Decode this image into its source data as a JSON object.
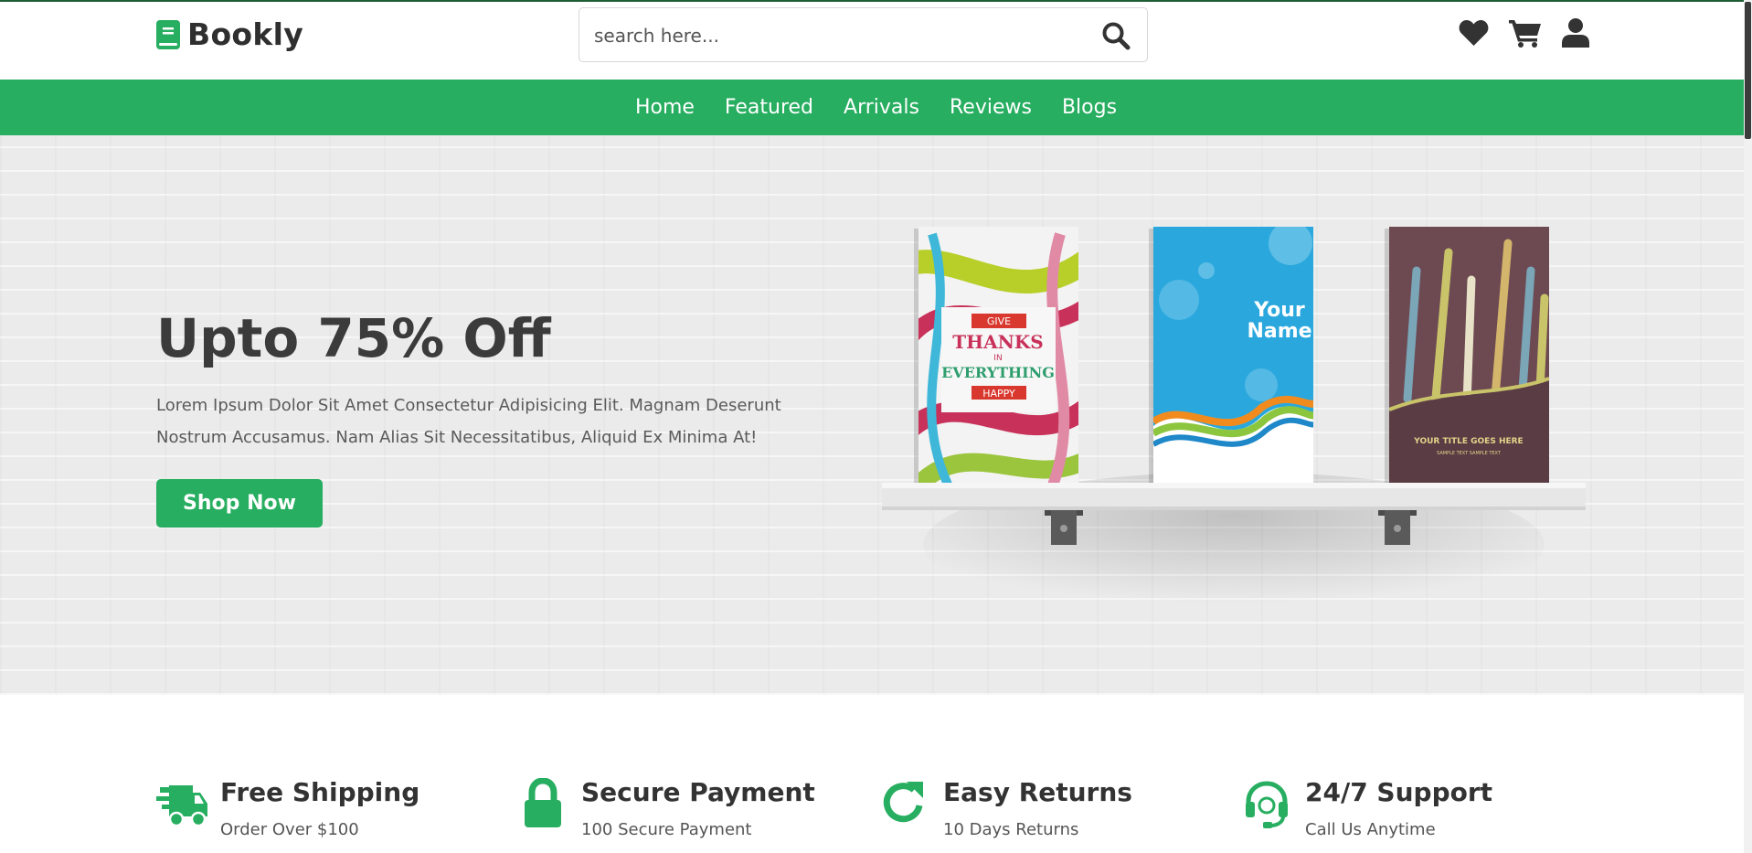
{
  "brand": {
    "name": "Bookly",
    "accent": "#27ae60"
  },
  "search": {
    "placeholder": "search here..."
  },
  "header_icons": [
    "heart-icon",
    "cart-icon",
    "user-icon"
  ],
  "nav": {
    "items": [
      {
        "label": "Home"
      },
      {
        "label": "Featured"
      },
      {
        "label": "Arrivals"
      },
      {
        "label": "Reviews"
      },
      {
        "label": "Blogs"
      }
    ]
  },
  "hero": {
    "title": "Upto 75% Off",
    "text": "Lorem Ipsum Dolor Sit Amet Consectetur Adipisicing Elit. Magnam Deserunt Nostrum Accusamus. Nam Alias Sit Necessitatibus, Aliquid Ex Minima At!",
    "button": "Shop Now",
    "books": [
      {
        "line1": "GIVE",
        "line2": "THANKS",
        "line3": "IN",
        "line4": "EVERYTHING",
        "line5": "HAPPY"
      },
      {
        "line1": "Your",
        "line2": "Name"
      },
      {
        "line1": "YOUR TITLE GOES HERE",
        "line2": "SAMPLE TEXT SAMPLE TEXT"
      }
    ]
  },
  "features": [
    {
      "icon": "truck-icon",
      "title": "Free Shipping",
      "subtitle": "Order Over $100"
    },
    {
      "icon": "lock-icon",
      "title": "Secure Payment",
      "subtitle": "100 Secure Payment"
    },
    {
      "icon": "redo-icon",
      "title": "Easy Returns",
      "subtitle": "10 Days Returns"
    },
    {
      "icon": "headset-icon",
      "title": "24/7 Support",
      "subtitle": "Call Us Anytime"
    }
  ]
}
